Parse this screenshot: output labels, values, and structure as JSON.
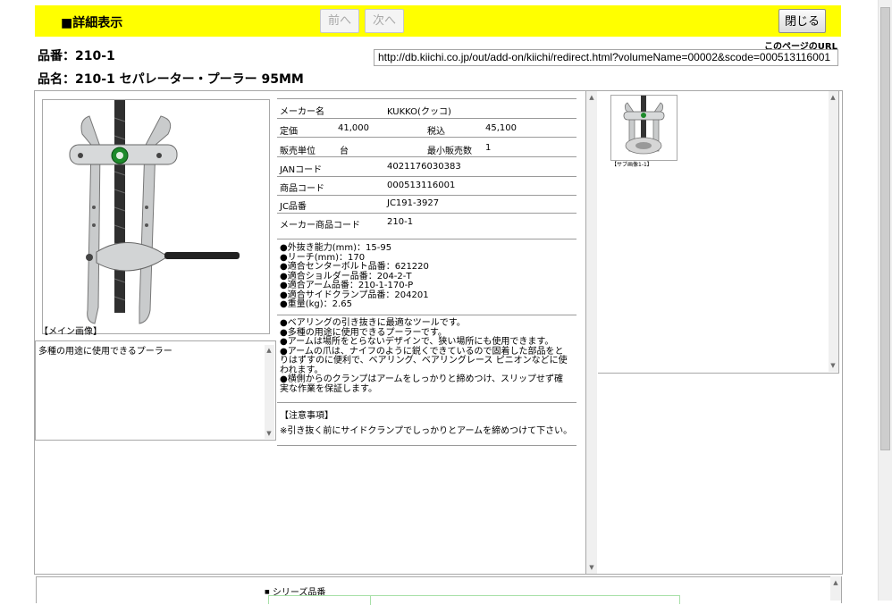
{
  "header": {
    "title": "■詳細表示",
    "prev_label": "前へ",
    "next_label": "次へ",
    "close_label": "閉じる"
  },
  "product": {
    "part_number_line": "品番：210-1",
    "name_line": "品名：210-1 セパレーター・プーラー 95MM"
  },
  "page_url": {
    "label": "このページのURL",
    "value": "http://db.kiichi.co.jp/out/add-on/kiichi/redirect.html?volumeName=00002&scode=000513116001"
  },
  "main_image": {
    "caption": "【メイン画像】"
  },
  "description_box": "多種の用途に使用できるプーラー",
  "spec": {
    "maker_label": "メーカー名",
    "maker_value": "KUKKO(クッコ)",
    "list_price_label": "定価",
    "list_price_value": "41,000",
    "tax_incl_label": "税込",
    "tax_incl_value": "45,100",
    "unit_label": "販売単位",
    "unit_value": "台",
    "min_qty_label": "最小販売数",
    "min_qty_value": "1",
    "jan_label": "JANコード",
    "jan_value": "4021176030383",
    "product_code_label": "商品コード",
    "product_code_value": "000513116001",
    "jc_label": "JC品番",
    "jc_value": "JC191-3927",
    "maker_code_label": "メーカー商品コード",
    "maker_code_value": "210-1"
  },
  "features": [
    "●外抜き能力(mm)：15-95",
    "●リーチ(mm)：170",
    "●適合センターボルト品番：621220",
    "●適合ショルダー品番：204-2-T",
    "●適合アーム品番：210-1-170-P",
    "●適合サイドクランプ品番：204201",
    "●重量(kg)：2.65"
  ],
  "description_text": "●ベアリングの引き抜きに最適なツールです。\n●多種の用途に使用できるプーラーです。\n●アームは場所をとらないデザインで、狭い場所にも使用できます。\n●アームの爪は、ナイフのように鋭くできているので固着した部品をとりはずすのに便利で、ベアリング、ベアリングレース ピニオンなどに使われます。\n●横側からのクランプはアームをしっかりと締めつけ、スリップせず確実な作業を保証します。",
  "notes": {
    "title": "【注意事項】",
    "text": "※引き抜く前にサイドクランプでしっかりとアームを締めつけて下さい。"
  },
  "sub_image": {
    "caption": "【サブ画像1-1】"
  },
  "series": {
    "label": "シリーズ品番"
  },
  "colors": {
    "header_bg": "#ffff00",
    "border": "#a8a8a8",
    "series_border": "#a8e0a8"
  },
  "icons": {
    "up": "arrow-up-icon",
    "down": "arrow-down-icon",
    "bullet": "square-bullet-icon"
  }
}
